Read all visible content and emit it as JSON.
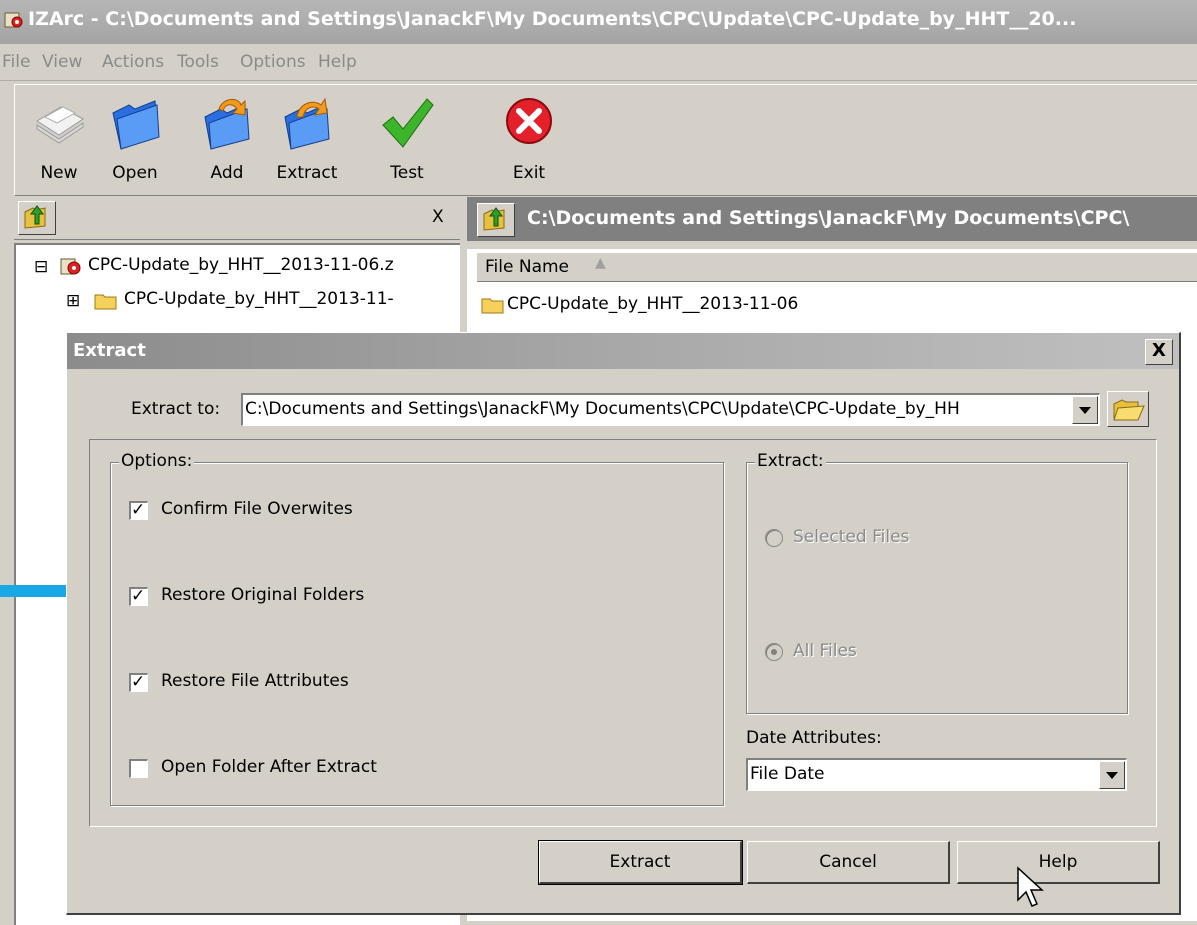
{
  "window": {
    "title": "IZArc - C:\\Documents and Settings\\JanackF\\My Documents\\CPC\\Update\\CPC-Update_by_HHT__20..."
  },
  "menu": [
    "File",
    "View",
    "Actions",
    "Tools",
    "Options",
    "Help"
  ],
  "toolbar": {
    "buttons": [
      {
        "label": "New",
        "icon": "new-archive-icon"
      },
      {
        "label": "Open",
        "icon": "open-folder-icon"
      },
      {
        "label": "Add",
        "icon": "add-folder-icon"
      },
      {
        "label": "Extract",
        "icon": "extract-folder-icon"
      },
      {
        "label": "Test",
        "icon": "checkmark-icon"
      },
      {
        "label": "Exit",
        "icon": "exit-icon"
      }
    ]
  },
  "left_panel": {
    "close_label": "X",
    "tree": [
      {
        "label": "CPC-Update_by_HHT__2013-11-06.z",
        "expander": "⊟"
      },
      {
        "label": "CPC-Update_by_HHT__2013-11-",
        "expander": "⊞"
      }
    ]
  },
  "right_panel": {
    "path": "C:\\Documents and Settings\\JanackF\\My Documents\\CPC\\",
    "column_header": "File Name",
    "files": [
      "CPC-Update_by_HHT__2013-11-06"
    ]
  },
  "dialog": {
    "title": "Extract",
    "close_label": "X",
    "extract_to_label": "Extract to:",
    "extract_to_value": "C:\\Documents and Settings\\JanackF\\My Documents\\CPC\\Update\\CPC-Update_by_HH",
    "options_label": "Options:",
    "options": [
      {
        "label": "Confirm File Overwites",
        "checked": true
      },
      {
        "label": "Restore Original Folders",
        "checked": true
      },
      {
        "label": "Restore File Attributes",
        "checked": true
      },
      {
        "label": "Open Folder After Extract",
        "checked": false
      }
    ],
    "extract_group_label": "Extract:",
    "radio_selected_files": "Selected Files",
    "radio_all_files": "All Files",
    "date_attributes_label": "Date Attributes:",
    "date_attributes_value": "File Date",
    "buttons": {
      "extract": "Extract",
      "cancel": "Cancel",
      "help": "Help"
    }
  },
  "colors": {
    "arrow_annotation": "#1aa7e6",
    "window_face": "#d4d0c8"
  }
}
